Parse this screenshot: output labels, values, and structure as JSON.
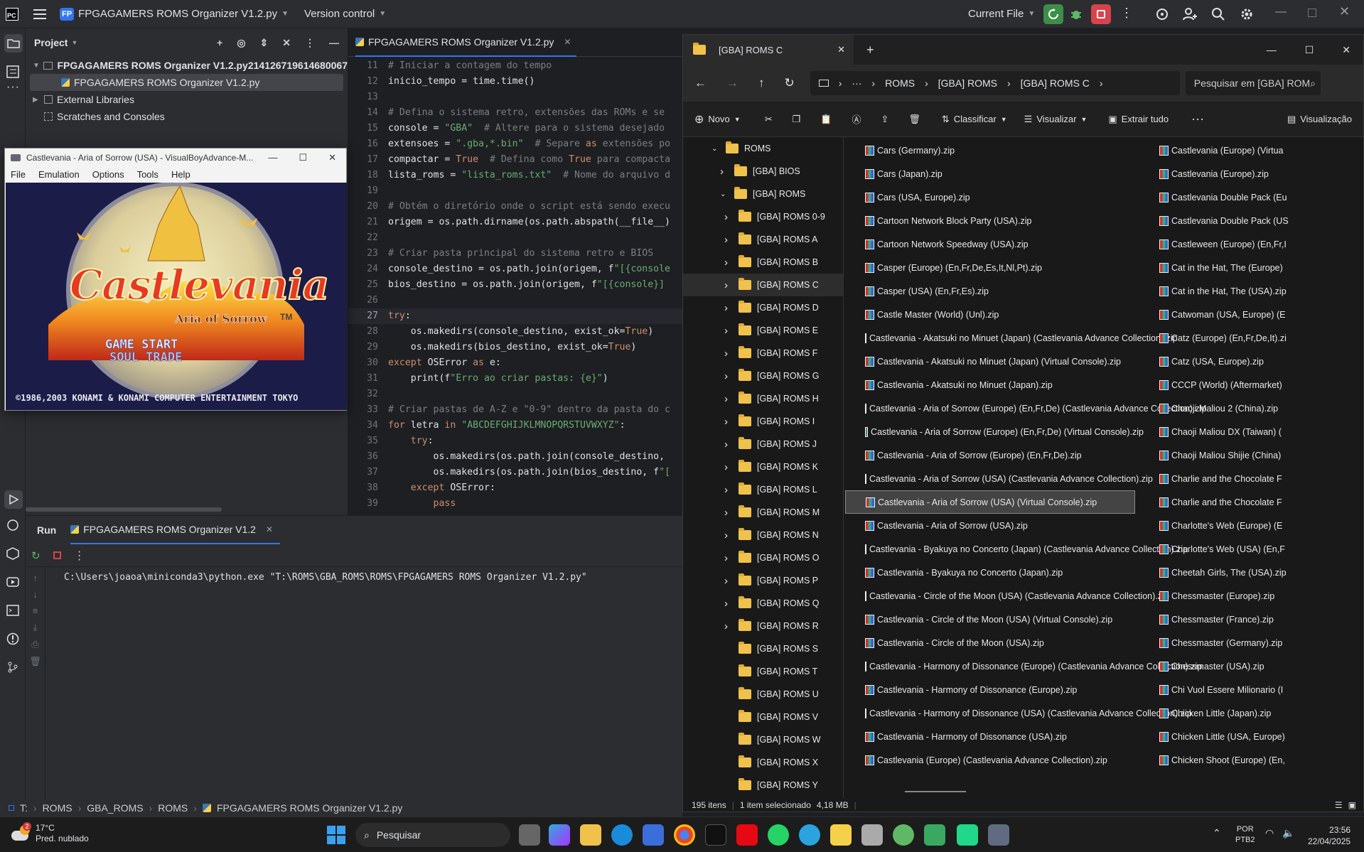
{
  "ide": {
    "logo": "PC",
    "project_badge": "FP",
    "project_name": "FPGAGAMERS ROMS Organizer V1.2.py",
    "vcs": "Version control",
    "run_config": "Current File",
    "project_panel_title": "Project",
    "tree": [
      "FPGAGAMERS ROMS Organizer V1.2.py214126719614680067",
      "FPGAGAMERS ROMS Organizer V1.2.py",
      "External Libraries",
      "Scratches and Consoles"
    ],
    "editor_tab": "FPGAGAMERS ROMS Organizer V1.2.py",
    "code_lines": [
      [
        "11",
        "# Iniciar a contagem do tempo"
      ],
      [
        "12",
        "inicio_tempo = time.time()"
      ],
      [
        "13",
        ""
      ],
      [
        "14",
        "# Defina o sistema retro, extensões das ROMs e se"
      ],
      [
        "15",
        "console = \"GBA\"  # Altere para o sistema desejado"
      ],
      [
        "16",
        "extensoes = \".gba,*.bin\"  # Separe as extensões po"
      ],
      [
        "17",
        "compactar = True  # Defina como True para compacta"
      ],
      [
        "18",
        "lista_roms = \"lista_roms.txt\"  # Nome do arquivo d"
      ],
      [
        "19",
        ""
      ],
      [
        "20",
        "# Obtém o diretório onde o script está sendo execu"
      ],
      [
        "21",
        "origem = os.path.dirname(os.path.abspath(__file__)"
      ],
      [
        "22",
        ""
      ],
      [
        "23",
        "# Criar pasta principal do sistema retro e BIOS"
      ],
      [
        "24",
        "console_destino = os.path.join(origem, f\"[{console"
      ],
      [
        "25",
        "bios_destino = os.path.join(origem, f\"[{console}] "
      ],
      [
        "26",
        ""
      ],
      [
        "27",
        "try:"
      ],
      [
        "28",
        "    os.makedirs(console_destino, exist_ok=True)"
      ],
      [
        "29",
        "    os.makedirs(bios_destino, exist_ok=True)"
      ],
      [
        "30",
        "except OSError as e:"
      ],
      [
        "31",
        "    print(f\"Erro ao criar pastas: {e}\")"
      ],
      [
        "32",
        ""
      ],
      [
        "33",
        "# Criar pastas de A-Z e \"0-9\" dentro da pasta do c"
      ],
      [
        "34",
        "for letra in \"ABCDEFGHIJKLMNOPQRSTUVWXYZ\":"
      ],
      [
        "35",
        "    try:"
      ],
      [
        "36",
        "        os.makedirs(os.path.join(console_destino,"
      ],
      [
        "37",
        "        os.makedirs(os.path.join(bios_destino, f\"["
      ],
      [
        "38",
        "    except OSError:"
      ],
      [
        "39",
        "        pass"
      ]
    ],
    "run_tab": "Run",
    "run_config_tab": "FPGAGAMERS ROMS Organizer V1.2",
    "console_output": "C:\\Users\\joaoa\\miniconda3\\python.exe \"T:\\ROMS\\GBA_ROMS\\ROMS\\FPGAGAMERS ROMS Organizer V1.2.py\"",
    "breadcrumb": [
      "T:",
      "ROMS",
      "GBA_ROMS",
      "ROMS",
      "FPGAGAMERS ROMS Organizer V1.2.py"
    ]
  },
  "emulator": {
    "title": "Castlevania - Aria of Sorrow (USA) - VisualBoyAdvance-M...",
    "menu": [
      "File",
      "Emulation",
      "Options",
      "Tools",
      "Help"
    ],
    "game_logo": "Castlevania",
    "game_subtitle": "Aria of Sorrow",
    "tm": "TM",
    "menu_start": "GAME START",
    "menu_trade": "SOUL TRADE",
    "copyright": "©1986,2003 KONAMI & KONAMI COMPUTER ENTERTAINMENT TOKYO"
  },
  "explorer": {
    "tab_title": "[GBA] ROMS C",
    "path": [
      "ROMS",
      "[GBA] ROMS",
      "[GBA] ROMS C"
    ],
    "search_placeholder": "Pesquisar em [GBA] ROM",
    "commands": {
      "new": "Novo",
      "sort": "Classificar",
      "view": "Visualizar",
      "extract": "Extrair tudo",
      "preview": "Visualização"
    },
    "nav_root": "ROMS",
    "nav_items": [
      "[GBA] BIOS",
      "[GBA] ROMS",
      "[GBA] ROMS 0-9",
      "[GBA] ROMS A",
      "[GBA] ROMS B",
      "[GBA] ROMS C",
      "[GBA] ROMS D",
      "[GBA] ROMS E",
      "[GBA] ROMS F",
      "[GBA] ROMS G",
      "[GBA] ROMS H",
      "[GBA] ROMS I",
      "[GBA] ROMS J",
      "[GBA] ROMS K",
      "[GBA] ROMS L",
      "[GBA] ROMS M",
      "[GBA] ROMS N",
      "[GBA] ROMS O",
      "[GBA] ROMS P",
      "[GBA] ROMS Q",
      "[GBA] ROMS R",
      "[GBA] ROMS S",
      "[GBA] ROMS T",
      "[GBA] ROMS U",
      "[GBA] ROMS V",
      "[GBA] ROMS W",
      "[GBA] ROMS X",
      "[GBA] ROMS Y"
    ],
    "files_col1": [
      "Cars (Germany).zip",
      "Cars (Japan).zip",
      "Cars (USA, Europe).zip",
      "Cartoon Network Block Party (USA).zip",
      "Cartoon Network Speedway (USA).zip",
      "Casper (Europe) (En,Fr,De,Es,It,Nl,Pt).zip",
      "Casper (USA) (En,Fr,Es).zip",
      "Castle Master (World) (Unl).zip",
      "Castlevania - Akatsuki no Minuet (Japan) (Castlevania Advance Collection).zip",
      "Castlevania - Akatsuki no Minuet (Japan) (Virtual Console).zip",
      "Castlevania - Akatsuki no Minuet (Japan).zip",
      "Castlevania - Aria of Sorrow (Europe) (En,Fr,De) (Castlevania Advance Collection).zip",
      "Castlevania - Aria of Sorrow (Europe) (En,Fr,De) (Virtual Console).zip",
      "Castlevania - Aria of Sorrow (Europe) (En,Fr,De).zip",
      "Castlevania - Aria of Sorrow (USA) (Castlevania Advance Collection).zip",
      "Castlevania - Aria of Sorrow (USA) (Virtual Console).zip",
      "Castlevania - Aria of Sorrow (USA).zip",
      "Castlevania - Byakuya no Concerto (Japan) (Castlevania Advance Collection).zip",
      "Castlevania - Byakuya no Concerto (Japan).zip",
      "Castlevania - Circle of the Moon (USA) (Castlevania Advance Collection).zip",
      "Castlevania - Circle of the Moon (USA) (Virtual Console).zip",
      "Castlevania - Circle of the Moon (USA).zip",
      "Castlevania - Harmony of Dissonance (Europe) (Castlevania Advance Collection).zip",
      "Castlevania - Harmony of Dissonance (Europe).zip",
      "Castlevania - Harmony of Dissonance (USA) (Castlevania Advance Collection).zip",
      "Castlevania - Harmony of Dissonance (USA).zip",
      "Castlevania (Europe) (Castlevania Advance Collection).zip"
    ],
    "files_col2": [
      "Castlevania (Europe) (Virtua",
      "Castlevania (Europe).zip",
      "Castlevania Double Pack (Eu",
      "Castlevania Double Pack (US",
      "Castleween (Europe) (En,Fr,I",
      "Cat in the Hat, The (Europe)",
      "Cat in the Hat, The (USA).zip",
      "Catwoman (USA, Europe) (E",
      "Catz (Europe) (En,Fr,De,It).zi",
      "Catz (USA, Europe).zip",
      "CCCP (World) (Aftermarket)",
      "Chaoji Maliou 2 (China).zip",
      "Chaoji Maliou DX (Taiwan) (",
      "Chaoji Maliou Shijie (China)",
      "Charlie and the Chocolate F",
      "Charlie and the Chocolate F",
      "Charlotte's Web (Europe) (E",
      "Charlotte's Web (USA) (En,F",
      "Cheetah Girls, The (USA).zip",
      "Chessmaster (Europe).zip",
      "Chessmaster (France).zip",
      "Chessmaster (Germany).zip",
      "Chessmaster (USA).zip",
      "Chi Vuol Essere Milionario (I",
      "Chicken Little (Japan).zip",
      "Chicken Little (USA, Europe)",
      "Chicken Shoot (Europe) (En,"
    ],
    "selected_index": 15,
    "status": {
      "count": "195 itens",
      "selected": "1 item selecionado",
      "size": "4,18 MB"
    }
  },
  "taskbar": {
    "weather_badge": "2",
    "temp": "17°C",
    "weather": "Pred. nublado",
    "search": "Pesquisar",
    "lang1": "POR",
    "lang2": "PTB2",
    "time": "23:56",
    "date": "22/04/2025"
  },
  "colors": {
    "ide_bg": "#1e1f22",
    "ide_panel": "#2b2d30",
    "run_green": "#3b8f47",
    "stop_red": "#d9434b",
    "selection": "#2e436e",
    "keyword": "#cf8e6d",
    "string": "#6aab73",
    "comment": "#7a7e85",
    "explorer_bg": "#191919"
  }
}
